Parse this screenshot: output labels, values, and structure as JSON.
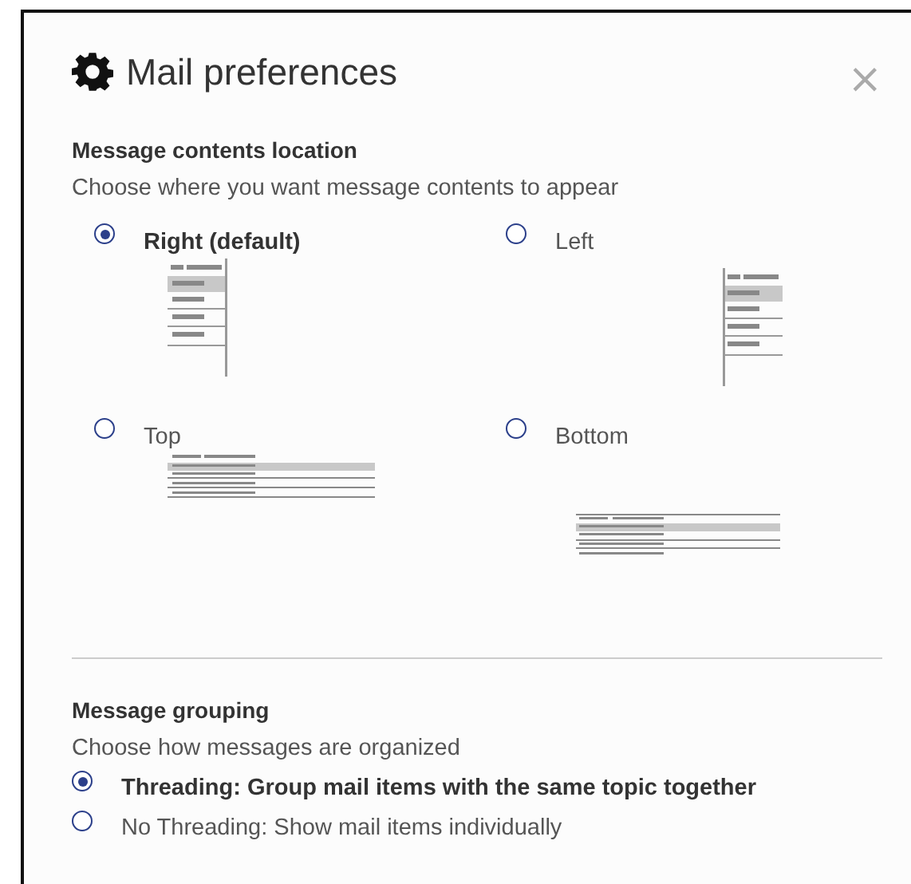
{
  "dialog": {
    "title": "Mail preferences",
    "close": "×"
  },
  "location": {
    "heading": "Message contents location",
    "description": "Choose where you want message contents to appear",
    "options": [
      {
        "label": "Right (default)",
        "kind": "right",
        "selected": true
      },
      {
        "label": "Left",
        "kind": "left",
        "selected": false
      },
      {
        "label": "Top",
        "kind": "top",
        "selected": false
      },
      {
        "label": "Bottom",
        "kind": "bottom",
        "selected": false
      }
    ]
  },
  "grouping": {
    "heading": "Message grouping",
    "description": "Choose how messages are organized",
    "options": [
      {
        "label": "Threading: Group mail items with the same topic together",
        "selected": true
      },
      {
        "label": "No Threading: Show mail items individually",
        "selected": false
      }
    ]
  }
}
